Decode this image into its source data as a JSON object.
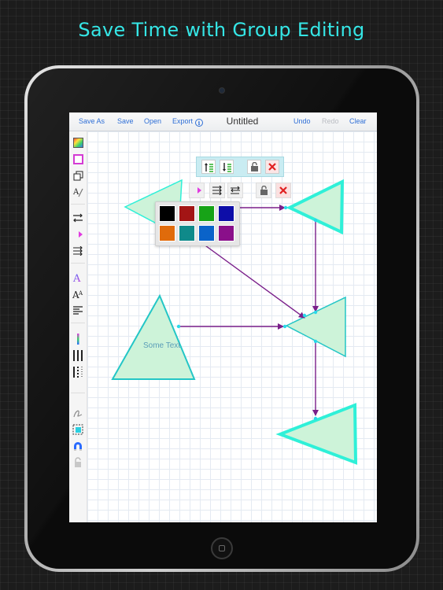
{
  "headline": "Save Time with Group Editing",
  "navbar": {
    "save_as": "Save As",
    "save": "Save",
    "open": "Open",
    "export": "Export",
    "title": "Untitled",
    "undo": "Undo",
    "redo": "Redo",
    "clear": "Clear"
  },
  "toolbar": {
    "icons": [
      "fill-color-icon",
      "stroke-color-icon",
      "duplicate-icon",
      "text-style-icon",
      "line-style-icon",
      "arrow-color-icon",
      "arrow-style-icon",
      "font-color-icon",
      "font-size-icon",
      "text-align-icon",
      "line-width-icon",
      "line-dash-icon",
      "line-dot-icon",
      "freehand-pen-icon",
      "group-select-icon",
      "magnet-icon",
      "lock-icon"
    ]
  },
  "floating_toolbar": {
    "icons": [
      "bring-forward-icon",
      "send-backward-icon",
      "unlock-icon",
      "delete-icon"
    ]
  },
  "sub_toolbar": {
    "icons": [
      "arrow-color-icon",
      "arrow-style-icon",
      "arrow-swap-icon",
      "unlock-icon",
      "delete-icon"
    ]
  },
  "palette": {
    "colors": [
      "#000000",
      "#a31515",
      "#17a317",
      "#0d0da8",
      "#e06b0b",
      "#0f8a8a",
      "#0a63c9",
      "#8a0f8a"
    ]
  },
  "canvas": {
    "shape_text": "Some Text",
    "triangle_fill": "#cdf3d9",
    "triangle_stroke": "#23c6c6",
    "selected_stroke": "#2ff0d8",
    "arrow_color": "#7a1f8a"
  },
  "colors": {
    "headline": "#35e6e6",
    "nav_link": "#2f6fd6",
    "nav_disabled": "#b9bcc2"
  }
}
